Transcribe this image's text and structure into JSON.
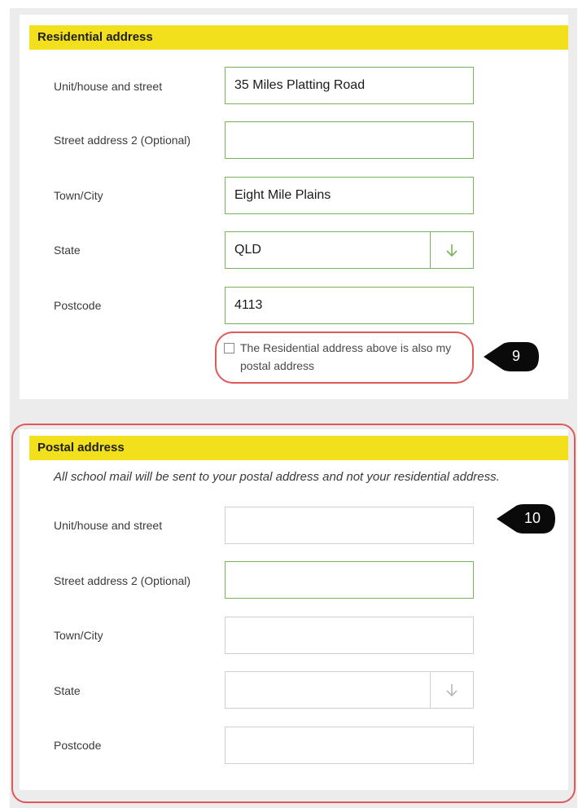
{
  "residential": {
    "header": "Residential address",
    "fields": {
      "street": {
        "label": "Unit/house and street",
        "value": "35 Miles Platting Road"
      },
      "street2": {
        "label": "Street address 2 (Optional)",
        "value": ""
      },
      "town": {
        "label": "Town/City",
        "value": "Eight Mile Plains"
      },
      "state": {
        "label": "State",
        "value": "QLD"
      },
      "postcode": {
        "label": "Postcode",
        "value": "4113"
      }
    },
    "checkbox_label": "The Residential address above is also my postal address",
    "checkbox_checked": false
  },
  "postal": {
    "header": "Postal address",
    "intro": "All school mail will be sent to your postal address and not your residential address.",
    "fields": {
      "street": {
        "label": "Unit/house and street",
        "value": ""
      },
      "street2": {
        "label": "Street address 2 (Optional)",
        "value": ""
      },
      "town": {
        "label": "Town/City",
        "value": ""
      },
      "state": {
        "label": "State",
        "value": ""
      },
      "postcode": {
        "label": "Postcode",
        "value": ""
      }
    }
  },
  "callouts": {
    "checkbox_step": "9",
    "postal_step": "10"
  },
  "colors": {
    "header_bg": "#f2e01c",
    "valid_border": "#7cb25a",
    "annotation": "#e0585a"
  }
}
